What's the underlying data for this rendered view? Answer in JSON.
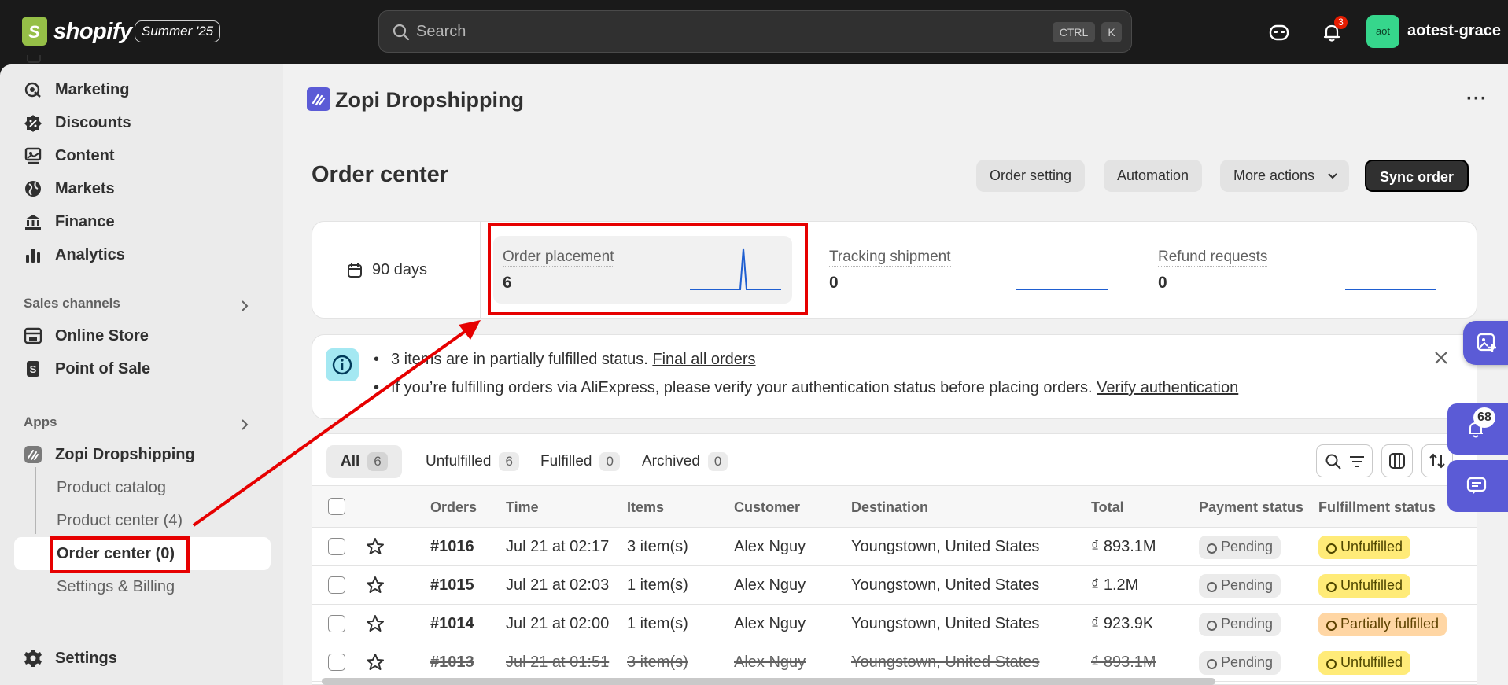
{
  "topbar": {
    "brand": "shopify",
    "brand_initial": "S",
    "edition_badge": "Summer '25",
    "search_placeholder": "Search",
    "shortcut_1": "CTRL",
    "shortcut_2": "K",
    "notification_count": "3",
    "avatar_initials": "aot",
    "username": "aotest-grace"
  },
  "sidebar": {
    "items": [
      {
        "label": "Marketing",
        "icon": "target-icon"
      },
      {
        "label": "Discounts",
        "icon": "discount-icon"
      },
      {
        "label": "Content",
        "icon": "content-icon"
      },
      {
        "label": "Markets",
        "icon": "globe-icon"
      },
      {
        "label": "Finance",
        "icon": "bank-icon"
      },
      {
        "label": "Analytics",
        "icon": "bar-chart-icon"
      }
    ],
    "sales_channels_label": "Sales channels",
    "channels": [
      {
        "label": "Online Store",
        "icon": "store-icon"
      },
      {
        "label": "Point of Sale",
        "icon": "pos-icon"
      }
    ],
    "apps_label": "Apps",
    "app_name": "Zopi Dropshipping",
    "app_subitems": [
      "Product catalog",
      "Product center (4)",
      "Order center (0)",
      "Settings & Billing"
    ],
    "settings_label": "Settings"
  },
  "main": {
    "app_title": "Zopi Dropshipping",
    "menu_dots": "···",
    "page_title": "Order center",
    "buttons": {
      "order_setting": "Order setting",
      "automation": "Automation",
      "more_actions": "More actions",
      "sync_order": "Sync order"
    },
    "stats": {
      "range": "90 days",
      "cards": [
        {
          "label": "Order placement",
          "value": "6",
          "sparkline": [
            0,
            0,
            0,
            0,
            0,
            0,
            0,
            0,
            0,
            0,
            0,
            0,
            0,
            0,
            0,
            0,
            0,
            6,
            0,
            0,
            0,
            0,
            0,
            0,
            0,
            0,
            0,
            0,
            0,
            0
          ]
        },
        {
          "label": "Tracking shipment",
          "value": "0",
          "sparkline": []
        },
        {
          "label": "Refund requests",
          "value": "0",
          "sparkline": []
        }
      ]
    },
    "banner": {
      "line1_text": "3 items are in partially fulfilled status.",
      "line1_link": "Final all orders",
      "line2_text": "If you’re fulfilling orders via AliExpress, please verify your authentication status before placing orders.",
      "line2_link": "Verify authentication"
    },
    "tabs": [
      {
        "label": "All",
        "count": "6"
      },
      {
        "label": "Unfulfilled",
        "count": "6"
      },
      {
        "label": "Fulfilled",
        "count": "0"
      },
      {
        "label": "Archived",
        "count": "0"
      }
    ],
    "columns": [
      "Orders",
      "Time",
      "Items",
      "Customer",
      "Destination",
      "Total",
      "Payment status",
      "Fulfillment status"
    ],
    "rows": [
      {
        "order": "#1016",
        "time": "Jul 21 at 02:17",
        "items": "3 item(s)",
        "customer": "Alex Nguy",
        "destination": "Youngstown, United States",
        "total": "₫ 893.1M",
        "payment": "Pending",
        "fulfillment": "Unfulfilled"
      },
      {
        "order": "#1015",
        "time": "Jul 21 at 02:03",
        "items": "1 item(s)",
        "customer": "Alex Nguy",
        "destination": "Youngstown, United States",
        "total": "₫ 1.2M",
        "payment": "Pending",
        "fulfillment": "Unfulfilled"
      },
      {
        "order": "#1014",
        "time": "Jul 21 at 02:00",
        "items": "1 item(s)",
        "customer": "Alex Nguy",
        "destination": "Youngstown, United States",
        "total": "₫ 923.9K",
        "payment": "Pending",
        "fulfillment": "Partially fulfilled"
      },
      {
        "order": "#1013",
        "time": "Jul 21 at 01:51",
        "items": "3 item(s)",
        "customer": "Alex Nguy",
        "destination": "Youngstown, United States",
        "total": "₫ 893.1M",
        "payment": "Pending",
        "fulfillment": "Unfulfilled"
      }
    ]
  },
  "widgets": {
    "notification_count": "68"
  },
  "colors": {
    "accent": "#5b5bd6",
    "annotation": "#e60000",
    "sparkline": "#1f5fd1"
  }
}
